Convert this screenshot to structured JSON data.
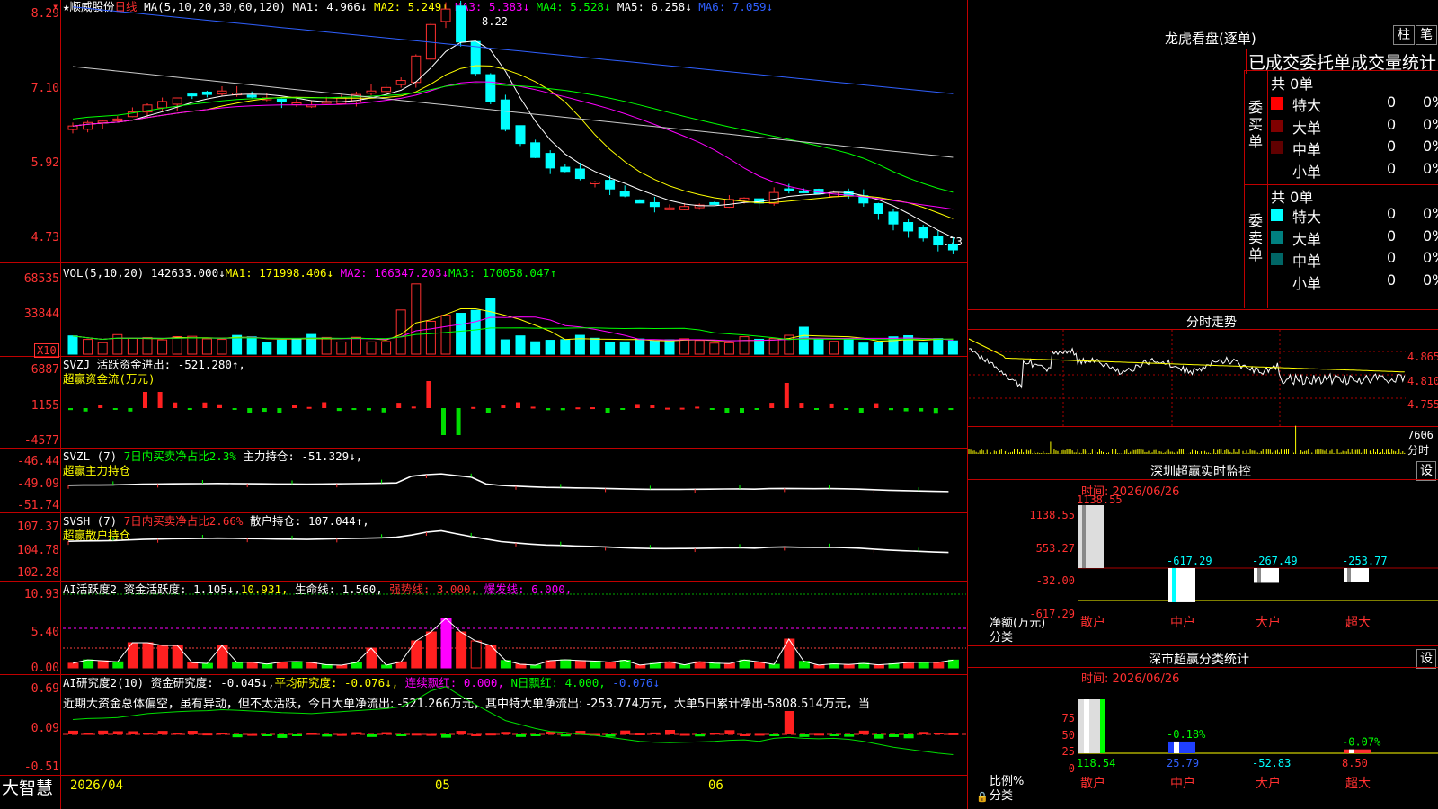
{
  "stock": {
    "name": "顺威股份",
    "period": "日线",
    "ma_header": "MA(5,10,20,30,60,120)",
    "ma_values": [
      {
        "label": "MA1:",
        "value": "4.966↓",
        "color": "#ffffff"
      },
      {
        "label": "MA2:",
        "value": "5.249↓",
        "color": "#ffff00"
      },
      {
        "label": "MA3:",
        "value": "5.383↓",
        "color": "#ff00ff"
      },
      {
        "label": "MA4:",
        "value": "5.528↓",
        "color": "#00ff00"
      },
      {
        "label": "MA5:",
        "value": "6.258↓",
        "color": "#ffffff"
      },
      {
        "label": "MA6:",
        "value": "7.059↓",
        "color": "#3060ff"
      }
    ],
    "high_mark": "8.22",
    "low_mark": "4.73",
    "price_axis": [
      "8.29",
      "7.10",
      "5.92",
      "4.73"
    ]
  },
  "vol": {
    "title": "VOL(5,10,20)",
    "value": "142633.000↓",
    "ma1": "MA1: 171998.406↓",
    "ma2": "MA2: 166347.203↓",
    "ma3": "MA3: 170058.047↑",
    "axis": [
      "68535",
      "33844"
    ],
    "unit": "X10"
  },
  "svzj": {
    "title": "SVZJ",
    "line1": "活跃资金进出: -521.280↑,",
    "line2": "超赢资金流(万元)",
    "axis": [
      "6887",
      "1155",
      "-4577"
    ]
  },
  "svzl": {
    "title": "SVZL (7)",
    "pct": "7日内买卖净占比2.3%",
    "hold": "主力持仓: -51.329↓,",
    "line2": "超赢主力持仓",
    "axis": [
      "-46.44",
      "-49.09",
      "-51.74"
    ]
  },
  "svsh": {
    "title": "SVSH (7)",
    "pct": "7日内买卖净占比2.66%",
    "hold": "散户持仓: 107.044↑,",
    "line2": "超赢散户持仓",
    "axis": [
      "107.37",
      "104.78",
      "102.28"
    ]
  },
  "ai_act": {
    "title": "AI活跃度2",
    "a": "资金活跃度: 1.105↓,",
    "b": "10.931,",
    "c": "生命线: 1.560,",
    "d": "强势线: 3.000,",
    "e": "爆发线: 6.000,",
    "axis": [
      "10.93",
      "5.40",
      "0.00"
    ]
  },
  "ai_res": {
    "title": "AI研究度2(10)",
    "a": "资金研究度: -0.045↓,",
    "b": "平均研究度: -0.076↓,",
    "c": "连续飘红: 0.000,",
    "d": "N日飘红: 4.000,",
    "e": "-0.076↓",
    "comment": "近期大资金总体偏空，虽有异动，但不太活跃，今日大单净流出: -521.266万元，其中特大单净流出: -253.774万元，大单5日累计净出-5808.514万元，当",
    "axis": [
      "0.69",
      "0.09",
      "-0.51"
    ]
  },
  "bottom": {
    "brand": "大智慧",
    "dates": [
      "2026/04",
      "05",
      "06"
    ]
  },
  "dragon": {
    "title": "龙虎看盘(逐单)",
    "btn1": "柱",
    "btn2": "笔",
    "tab_header": "已成交委托单成交量统计",
    "buy_label": "委买单",
    "sell_label": "委卖单",
    "buy_total": "共 0单",
    "sell_total": "共 0单",
    "buy_rows": [
      {
        "name": "特大",
        "count": "0",
        "pct": "0%",
        "color": "#ff0000"
      },
      {
        "name": "大单",
        "count": "0",
        "pct": "0%",
        "color": "#800000"
      },
      {
        "name": "中单",
        "count": "0",
        "pct": "0%",
        "color": "#600000"
      },
      {
        "name": "小单",
        "count": "0",
        "pct": "0%",
        "color": "#000000"
      }
    ],
    "sell_rows": [
      {
        "name": "特大",
        "count": "0",
        "pct": "0%",
        "color": "#00ffff"
      },
      {
        "name": "大单",
        "count": "0",
        "pct": "0%",
        "color": "#008080"
      },
      {
        "name": "中单",
        "count": "0",
        "pct": "0%",
        "color": "#006666"
      },
      {
        "name": "小单",
        "count": "0",
        "pct": "0%",
        "color": "#000000"
      }
    ]
  },
  "intraday": {
    "title": "分时走势",
    "axis": [
      "4.865",
      "4.810",
      "4.755"
    ],
    "vol_axis": "7606",
    "vol_unit": "分时"
  },
  "monitor": {
    "title": "深圳超赢实时监控",
    "btn": "设",
    "time": "时间: 2026/06/26",
    "axis": [
      "1138.55",
      "553.27",
      "-32.00",
      "-617.29"
    ],
    "ylabel": "净额(万元)",
    "xlabel": "分类",
    "bars": [
      {
        "cat": "散户",
        "value": 1138.55,
        "label": "1138.55"
      },
      {
        "cat": "中户",
        "value": -617.29,
        "label": "-617.29"
      },
      {
        "cat": "大户",
        "value": -267.49,
        "label": "-267.49"
      },
      {
        "cat": "超大",
        "value": -253.77,
        "label": "-253.77"
      }
    ]
  },
  "classify": {
    "title": "深市超赢分类统计",
    "btn": "设",
    "time": "时间: 2026/06/26",
    "axis": [
      "75",
      "50",
      "25",
      "0"
    ],
    "ylabel": "比例%",
    "xlabel": "分类",
    "bars": [
      {
        "cat": "散户",
        "value": 118.54,
        "label": "118.54",
        "pct": ""
      },
      {
        "cat": "中户",
        "value": 25.79,
        "label": "25.79",
        "pct": "-0.18%"
      },
      {
        "cat": "大户",
        "value": -52.83,
        "label": "-52.83",
        "pct": ""
      },
      {
        "cat": "超大",
        "value": 8.5,
        "label": "8.50",
        "pct": "-0.07%"
      }
    ]
  }
}
